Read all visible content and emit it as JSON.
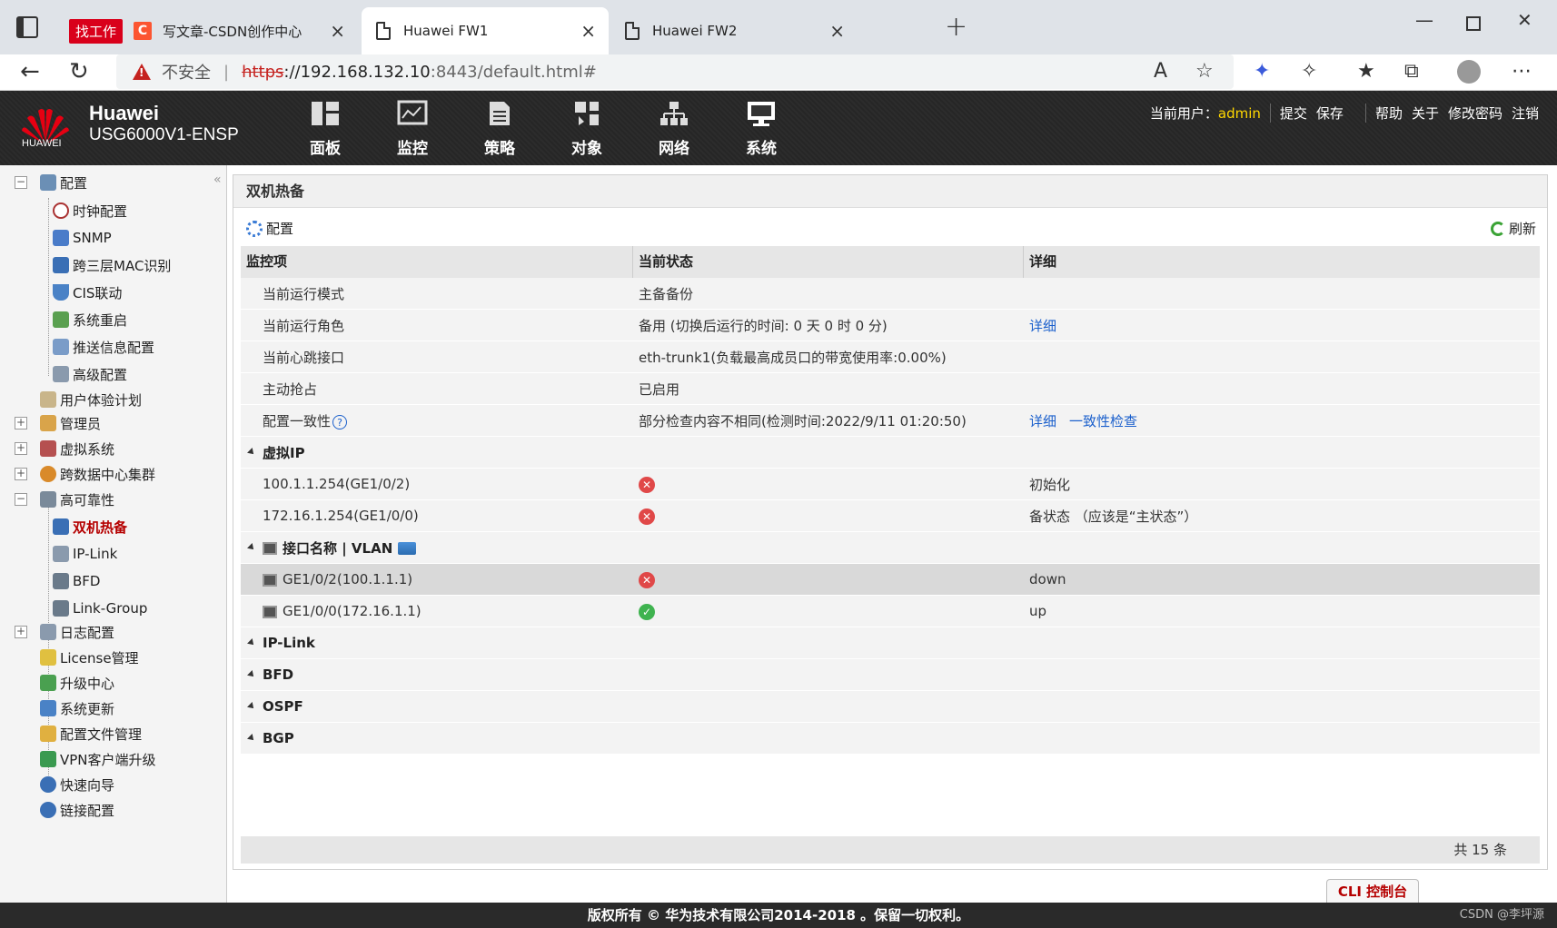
{
  "browser": {
    "tabs": [
      {
        "badge": "找工作",
        "title": "写文章-CSDN创作中心"
      },
      {
        "title": "Huawei FW1"
      },
      {
        "title": "Huawei FW2"
      }
    ],
    "insecure_label": "不安全",
    "url_scheme": "https",
    "url_host": "://192.168.132.10",
    "url_rest": ":8443/default.html#"
  },
  "header": {
    "brand": "Huawei",
    "model": "USG6000V1-ENSP",
    "logo_text": "HUAWEI",
    "nav": [
      "面板",
      "监控",
      "策略",
      "对象",
      "网络",
      "系统"
    ],
    "user_label": "当前用户：",
    "user": "admin",
    "links": [
      "提交",
      "保存",
      "帮助",
      "关于",
      "修改密码",
      "注销"
    ]
  },
  "sidebar": {
    "items": [
      {
        "label": "配置"
      },
      {
        "label": "时钟配置"
      },
      {
        "label": "SNMP"
      },
      {
        "label": "跨三层MAC识别"
      },
      {
        "label": "CIS联动"
      },
      {
        "label": "系统重启"
      },
      {
        "label": "推送信息配置"
      },
      {
        "label": "高级配置"
      },
      {
        "label": "用户体验计划"
      },
      {
        "label": "管理员"
      },
      {
        "label": "虚拟系统"
      },
      {
        "label": "跨数据中心集群"
      },
      {
        "label": "高可靠性"
      },
      {
        "label": "双机热备"
      },
      {
        "label": "IP-Link"
      },
      {
        "label": "BFD"
      },
      {
        "label": "Link-Group"
      },
      {
        "label": "日志配置"
      },
      {
        "label": "License管理"
      },
      {
        "label": "升级中心"
      },
      {
        "label": "系统更新"
      },
      {
        "label": "配置文件管理"
      },
      {
        "label": "VPN客户端升级"
      },
      {
        "label": "快速向导"
      },
      {
        "label": "链接配置"
      }
    ]
  },
  "panel": {
    "title": "双机热备",
    "config": "配置",
    "refresh": "刷新",
    "columns": [
      "监控项",
      "当前状态",
      "详细"
    ],
    "rows": [
      {
        "item": "当前运行模式",
        "status": "主备备份",
        "detail": ""
      },
      {
        "item": "当前运行角色",
        "status": "备用 (切换后运行的时间: 0 天 0 时 0 分)",
        "detail": "详细"
      },
      {
        "item": "当前心跳接口",
        "status": "eth-trunk1(负载最高成员口的带宽使用率:0.00%)",
        "detail": ""
      },
      {
        "item": "主动抢占",
        "status": "已启用",
        "detail": ""
      },
      {
        "item": "配置一致性",
        "status": "部分检查内容不相同(检测时间:2022/9/11 01:20:50)",
        "detail": "详细",
        "detail2": "一致性检查"
      }
    ],
    "group_vip": "虚拟IP",
    "vip_rows": [
      {
        "item": "100.1.1.254(GE1/0/2)",
        "detail": "初始化"
      },
      {
        "item": "172.16.1.254(GE1/0/0)",
        "detail": "备状态 （应该是“主状态”）"
      }
    ],
    "group_if": "接口名称 | VLAN",
    "if_rows": [
      {
        "item": "GE1/0/2(100.1.1.1)",
        "detail": "down"
      },
      {
        "item": "GE1/0/0(172.16.1.1)",
        "detail": "up"
      }
    ],
    "groups_other": [
      "IP-Link",
      "BFD",
      "OSPF",
      "BGP"
    ],
    "total": "共 15 条"
  },
  "cli": "CLI 控制台",
  "footer": "版权所有 © 华为技术有限公司2014-2018 。保留一切权利。",
  "watermark": "CSDN @李坪源",
  "colors": {
    "selected": "#b50000",
    "link": "#1a5fcc",
    "user": "#ffd700",
    "error": "#e04848",
    "ok": "#3fb34f"
  }
}
